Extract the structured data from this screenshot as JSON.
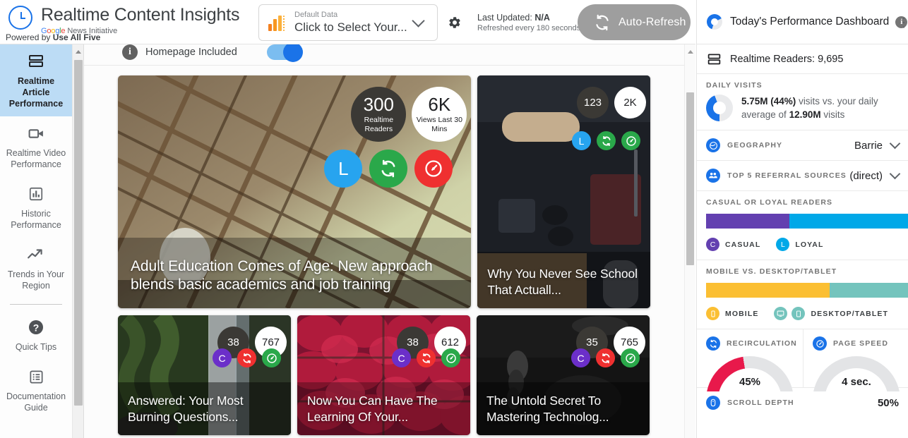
{
  "brand": {
    "title": "Realtime Content Insights",
    "subtitle_google": "Google",
    "subtitle_rest": "News Initiative",
    "powered_prefix": "Powered by",
    "powered_name": "Use All Five"
  },
  "toolbar": {
    "data_select_label": "Default Data",
    "data_select_value": "Click to Select Your...",
    "gear_icon": "gear-icon",
    "last_updated_label": "Last Updated:",
    "last_updated_value": "N/A",
    "refresh_note": "Refreshed every 180 seconds",
    "auto_refresh_label": "Auto-Refresh"
  },
  "sidebar": {
    "items": [
      {
        "label": "Realtime Article Performance",
        "icon": "article-rows-icon",
        "active": true
      },
      {
        "label": "Realtime Video Performance",
        "icon": "video-camera-icon",
        "active": false
      },
      {
        "label": "Historic Performance",
        "icon": "bar-chart-icon",
        "active": false
      },
      {
        "label": "Trends in Your Region",
        "icon": "trend-line-icon",
        "active": false
      }
    ],
    "items2": [
      {
        "label": "Quick Tips",
        "icon": "question-mark-icon"
      },
      {
        "label": "Documentation Guide",
        "icon": "document-list-icon"
      }
    ]
  },
  "main": {
    "homepage_included_label": "Homepage Included",
    "homepage_included_on": true,
    "cards": [
      {
        "title": "Adult Education Comes of Age: New approach blends basic academics and job training",
        "size": "big",
        "readers": "300",
        "readers_label": "Realtime Readers",
        "views": "6K",
        "views_label": "Views Last 30 Mins",
        "pills": [
          {
            "type": "loyal",
            "glyph": "L",
            "color": "blue"
          },
          {
            "type": "recirculation",
            "glyph": "sync-icon",
            "color": "green"
          },
          {
            "type": "page-speed",
            "glyph": "speed-icon",
            "color": "red"
          }
        ]
      },
      {
        "title": "Why You Never See School That Actuall...",
        "size": "tall",
        "readers": "123",
        "views": "2K",
        "pills": [
          {
            "type": "loyal",
            "glyph": "L",
            "color": "blue"
          },
          {
            "type": "recirculation",
            "glyph": "sync-icon",
            "color": "green"
          },
          {
            "type": "page-speed",
            "glyph": "speed-icon",
            "color": "green"
          }
        ]
      },
      {
        "title": "Answered: Your Most Burning Questions...",
        "size": "small",
        "readers": "38",
        "views": "767",
        "pills": [
          {
            "type": "casual",
            "glyph": "C",
            "color": "purple"
          },
          {
            "type": "recirculation",
            "glyph": "sync-icon",
            "color": "red"
          },
          {
            "type": "page-speed",
            "glyph": "speed-icon",
            "color": "green"
          }
        ]
      },
      {
        "title": "Now You Can Have The Learning Of Your...",
        "size": "small",
        "readers": "38",
        "views": "612",
        "pills": [
          {
            "type": "casual",
            "glyph": "C",
            "color": "purple"
          },
          {
            "type": "recirculation",
            "glyph": "sync-icon",
            "color": "red"
          },
          {
            "type": "page-speed",
            "glyph": "speed-icon",
            "color": "green"
          }
        ]
      },
      {
        "title": "The Untold Secret To Mastering Technolog...",
        "size": "small",
        "readers": "35",
        "views": "765",
        "pills": [
          {
            "type": "casual",
            "glyph": "C",
            "color": "purple"
          },
          {
            "type": "recirculation",
            "glyph": "sync-icon",
            "color": "red"
          },
          {
            "type": "page-speed",
            "glyph": "speed-icon",
            "color": "green"
          }
        ]
      }
    ]
  },
  "right_panel": {
    "title": "Today's Performance Dashboard",
    "more_menu": "⋮",
    "realtime_readers": "Realtime Readers: 9,695",
    "daily_visits": {
      "kicker": "DAILY VISITS",
      "value": "5.75M (44%)",
      "text_mid": "visits vs. your daily average of",
      "average": "12.90M",
      "text_end": "visits",
      "percent": 44
    },
    "geography": {
      "kicker": "GEOGRAPHY",
      "value": "Barrie",
      "icon": "globe-icon"
    },
    "referral": {
      "kicker": "TOP 5 REFERRAL SOURCES",
      "value": "(direct)",
      "icon": "people-icon"
    },
    "readers_mix": {
      "kicker": "CASUAL OR LOYAL READERS",
      "casual_label": "CASUAL",
      "casual_glyph": "C",
      "casual_pct": 41,
      "casual_color": "#6340b0",
      "loyal_label": "LOYAL",
      "loyal_glyph": "L",
      "loyal_pct": 59,
      "loyal_color": "#00a8e8"
    },
    "device_mix": {
      "kicker": "MOBILE VS. DESKTOP/TABLET",
      "mobile_label": "MOBILE",
      "mobile_pct": 61,
      "mobile_color": "#fbbf33",
      "desktop_label": "DESKTOP/TABLET",
      "desktop_pct": 39,
      "desktop_color": "#74c4bd"
    },
    "recirculation": {
      "kicker": "RECIRCULATION",
      "value": "45%",
      "percent": 45,
      "color": "#e8194b"
    },
    "page_speed": {
      "kicker": "PAGE SPEED",
      "value": "4 sec.",
      "percent": 6,
      "color": "#3f51b5"
    },
    "scroll_depth": {
      "kicker": "SCROLL DEPTH",
      "value": "50%",
      "icon": "mouse-icon"
    }
  }
}
